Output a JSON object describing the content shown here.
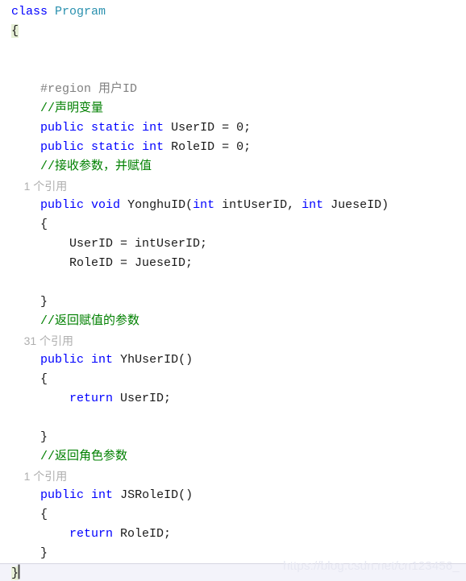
{
  "editor": {
    "language": "C#",
    "background_color": "#ffffff",
    "current_line_background": "#f3f3fa",
    "brace_match_background": "#e6eed6",
    "colors": {
      "keyword": "#0000ff",
      "type": "#2b91af",
      "comment": "#008000",
      "preprocessor": "#808080",
      "codelens": "#afafaf",
      "plain": "#1a1a1a",
      "caret": "#4a4a4a",
      "watermark": "#e7e8f2"
    },
    "caret_line": 30,
    "lines": [
      {
        "n": 1,
        "indent": 0,
        "tokens": [
          {
            "t": "class",
            "c": "keyword"
          },
          {
            "t": " ",
            "c": "plain"
          },
          {
            "t": "Program",
            "c": "type"
          }
        ]
      },
      {
        "n": 2,
        "indent": 0,
        "tokens": [
          {
            "t": "{",
            "c": "punct",
            "brace": true
          }
        ]
      },
      {
        "n": 3,
        "indent": 0,
        "tokens": []
      },
      {
        "n": 4,
        "indent": 0,
        "tokens": []
      },
      {
        "n": 5,
        "indent": 4,
        "tokens": [
          {
            "t": "#region 用户ID",
            "c": "preproc"
          }
        ]
      },
      {
        "n": 6,
        "indent": 4,
        "tokens": [
          {
            "t": "//声明变量",
            "c": "comment"
          }
        ]
      },
      {
        "n": 7,
        "indent": 4,
        "tokens": [
          {
            "t": "public",
            "c": "keyword"
          },
          {
            "t": " ",
            "c": "plain"
          },
          {
            "t": "static",
            "c": "keyword"
          },
          {
            "t": " ",
            "c": "plain"
          },
          {
            "t": "int",
            "c": "keyword"
          },
          {
            "t": " UserID = ",
            "c": "plain"
          },
          {
            "t": "0",
            "c": "number"
          },
          {
            "t": ";",
            "c": "punct"
          }
        ]
      },
      {
        "n": 8,
        "indent": 4,
        "tokens": [
          {
            "t": "public",
            "c": "keyword"
          },
          {
            "t": " ",
            "c": "plain"
          },
          {
            "t": "static",
            "c": "keyword"
          },
          {
            "t": " ",
            "c": "plain"
          },
          {
            "t": "int",
            "c": "keyword"
          },
          {
            "t": " RoleID = ",
            "c": "plain"
          },
          {
            "t": "0",
            "c": "number"
          },
          {
            "t": ";",
            "c": "punct"
          }
        ]
      },
      {
        "n": 9,
        "indent": 4,
        "tokens": [
          {
            "t": "//接收参数，并赋值",
            "c": "comment"
          }
        ]
      },
      {
        "n": 10,
        "indent": 4,
        "codelens": true,
        "tokens": [
          {
            "t": "1 个引用",
            "c": "codelens"
          }
        ]
      },
      {
        "n": 11,
        "indent": 4,
        "tokens": [
          {
            "t": "public",
            "c": "keyword"
          },
          {
            "t": " ",
            "c": "plain"
          },
          {
            "t": "void",
            "c": "keyword"
          },
          {
            "t": " YonghuID(",
            "c": "plain"
          },
          {
            "t": "int",
            "c": "keyword"
          },
          {
            "t": " intUserID, ",
            "c": "plain"
          },
          {
            "t": "int",
            "c": "keyword"
          },
          {
            "t": " JueseID)",
            "c": "plain"
          }
        ]
      },
      {
        "n": 12,
        "indent": 4,
        "tokens": [
          {
            "t": "{",
            "c": "punct"
          }
        ]
      },
      {
        "n": 13,
        "indent": 8,
        "tokens": [
          {
            "t": "UserID = intUserID;",
            "c": "plain"
          }
        ]
      },
      {
        "n": 14,
        "indent": 8,
        "tokens": [
          {
            "t": "RoleID = JueseID;",
            "c": "plain"
          }
        ]
      },
      {
        "n": 15,
        "indent": 0,
        "tokens": []
      },
      {
        "n": 16,
        "indent": 4,
        "tokens": [
          {
            "t": "}",
            "c": "punct"
          }
        ]
      },
      {
        "n": 17,
        "indent": 4,
        "tokens": [
          {
            "t": "//返回赋值的参数",
            "c": "comment"
          }
        ]
      },
      {
        "n": 18,
        "indent": 4,
        "codelens": true,
        "tokens": [
          {
            "t": "31 个引用",
            "c": "codelens"
          }
        ]
      },
      {
        "n": 19,
        "indent": 4,
        "tokens": [
          {
            "t": "public",
            "c": "keyword"
          },
          {
            "t": " ",
            "c": "plain"
          },
          {
            "t": "int",
            "c": "keyword"
          },
          {
            "t": " YhUserID()",
            "c": "plain"
          }
        ]
      },
      {
        "n": 20,
        "indent": 4,
        "tokens": [
          {
            "t": "{",
            "c": "punct"
          }
        ]
      },
      {
        "n": 21,
        "indent": 8,
        "tokens": [
          {
            "t": "return",
            "c": "keyword"
          },
          {
            "t": " UserID;",
            "c": "plain"
          }
        ]
      },
      {
        "n": 22,
        "indent": 0,
        "tokens": []
      },
      {
        "n": 23,
        "indent": 4,
        "tokens": [
          {
            "t": "}",
            "c": "punct"
          }
        ]
      },
      {
        "n": 24,
        "indent": 4,
        "tokens": [
          {
            "t": "//返回角色参数",
            "c": "comment"
          }
        ]
      },
      {
        "n": 25,
        "indent": 4,
        "codelens": true,
        "tokens": [
          {
            "t": "1 个引用",
            "c": "codelens"
          }
        ]
      },
      {
        "n": 26,
        "indent": 4,
        "tokens": [
          {
            "t": "public",
            "c": "keyword"
          },
          {
            "t": " ",
            "c": "plain"
          },
          {
            "t": "int",
            "c": "keyword"
          },
          {
            "t": " JSRoleID()",
            "c": "plain"
          }
        ]
      },
      {
        "n": 27,
        "indent": 4,
        "tokens": [
          {
            "t": "{",
            "c": "punct"
          }
        ]
      },
      {
        "n": 28,
        "indent": 8,
        "tokens": [
          {
            "t": "return",
            "c": "keyword"
          },
          {
            "t": " RoleID;",
            "c": "plain"
          }
        ]
      },
      {
        "n": 29,
        "indent": 4,
        "tokens": [
          {
            "t": "}",
            "c": "punct"
          }
        ]
      },
      {
        "n": 30,
        "indent": 0,
        "current": true,
        "caret": true,
        "tokens": [
          {
            "t": "}",
            "c": "punct",
            "brace": true
          }
        ]
      }
    ]
  },
  "watermark": {
    "text": "https://blog.csdn.net/cn123456_"
  }
}
